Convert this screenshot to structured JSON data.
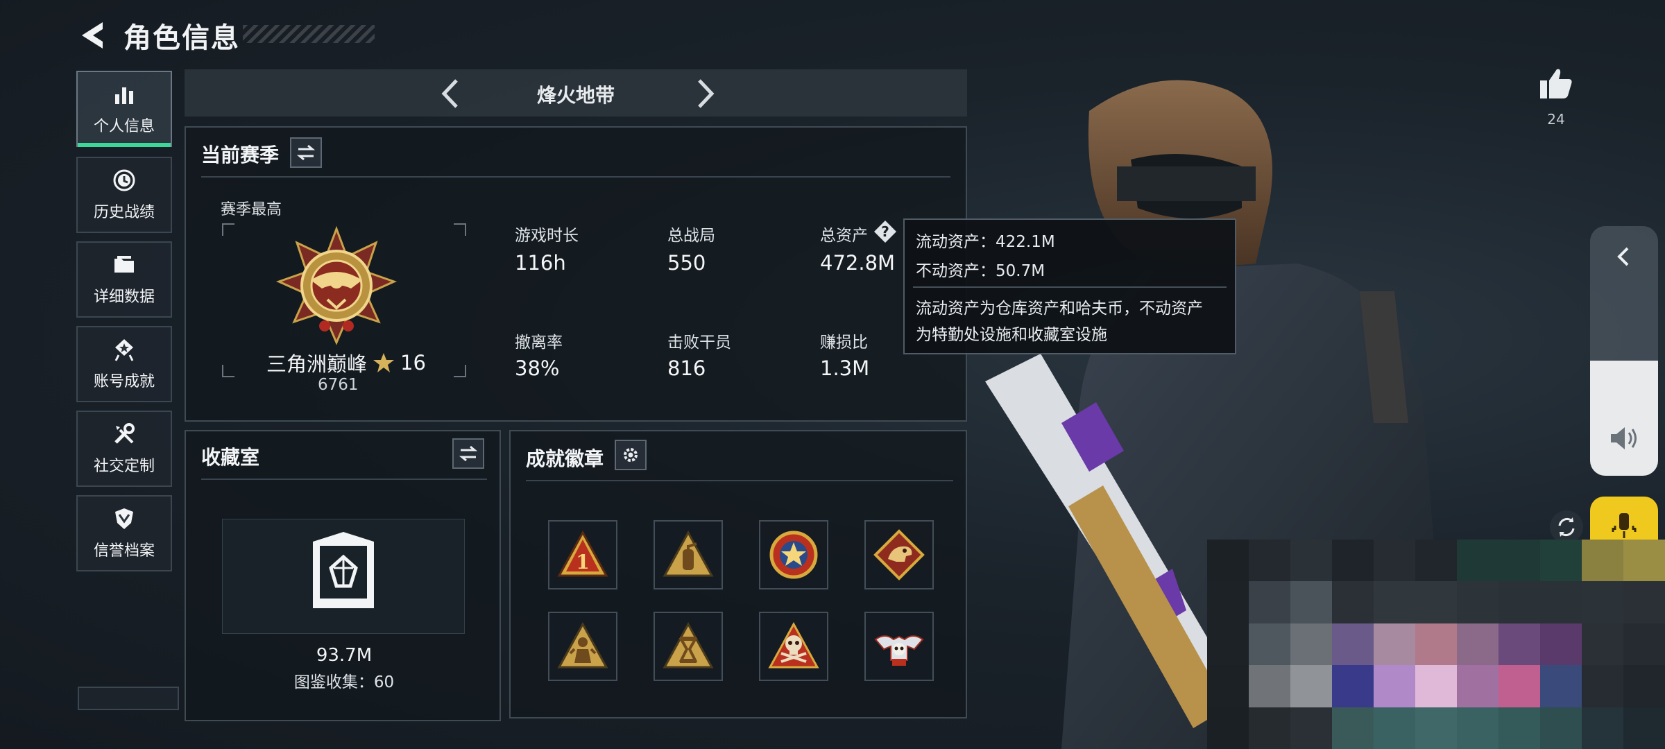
{
  "header": {
    "title": "角色信息"
  },
  "sidebar": {
    "items": [
      {
        "label": "个人信息",
        "icon": "bar-chart-icon",
        "active": true
      },
      {
        "label": "历史战绩",
        "icon": "history-clock-icon",
        "active": false
      },
      {
        "label": "详细数据",
        "icon": "folder-icon",
        "active": false
      },
      {
        "label": "账号成就",
        "icon": "achievement-icon",
        "active": false
      },
      {
        "label": "社交定制",
        "icon": "wrench-screwdriver-icon",
        "active": false
      },
      {
        "label": "信誉档案",
        "icon": "shield-icon",
        "active": false
      }
    ]
  },
  "season_nav": {
    "title": "烽火地带"
  },
  "current_season": {
    "title": "当前赛季",
    "highest_label": "赛季最高",
    "rank_name": "三角洲巅峰",
    "rank_stars": "16",
    "rank_points": "6761",
    "stats": [
      {
        "label": "游戏时长",
        "value": "116h"
      },
      {
        "label": "总战局",
        "value": "550"
      },
      {
        "label": "总资产",
        "value": "472.8M"
      },
      {
        "label": "撤离率",
        "value": "38%"
      },
      {
        "label": "击败干员",
        "value": "816"
      },
      {
        "label": "赚损比",
        "value": "1.3M"
      }
    ]
  },
  "asset_tooltip": {
    "liquid": "流动资产：422.1M",
    "fixed": "不动资产：50.7M",
    "note_line1": "流动资产为仓库资产和哈夫币，不动资产",
    "note_line2": "为特勤处设施和收藏室设施"
  },
  "collection": {
    "title": "收藏室",
    "value": "93.7M",
    "catalog": "图鉴收集：60"
  },
  "achievements": {
    "title": "成就徽章",
    "badges": [
      "badge-rank-one-icon",
      "badge-extinguisher-icon",
      "badge-star-emblem-icon",
      "badge-beast-icon",
      "badge-soldier-icon",
      "badge-hourglass-icon",
      "badge-skull-icon",
      "badge-winged-skull-icon"
    ]
  },
  "likes": {
    "count": "24"
  },
  "volume": {
    "level": 0.46
  },
  "colors": {
    "accent_green": "#3ed79a",
    "mic_yellow": "#f0c91f",
    "gold": "#c9a24a"
  }
}
